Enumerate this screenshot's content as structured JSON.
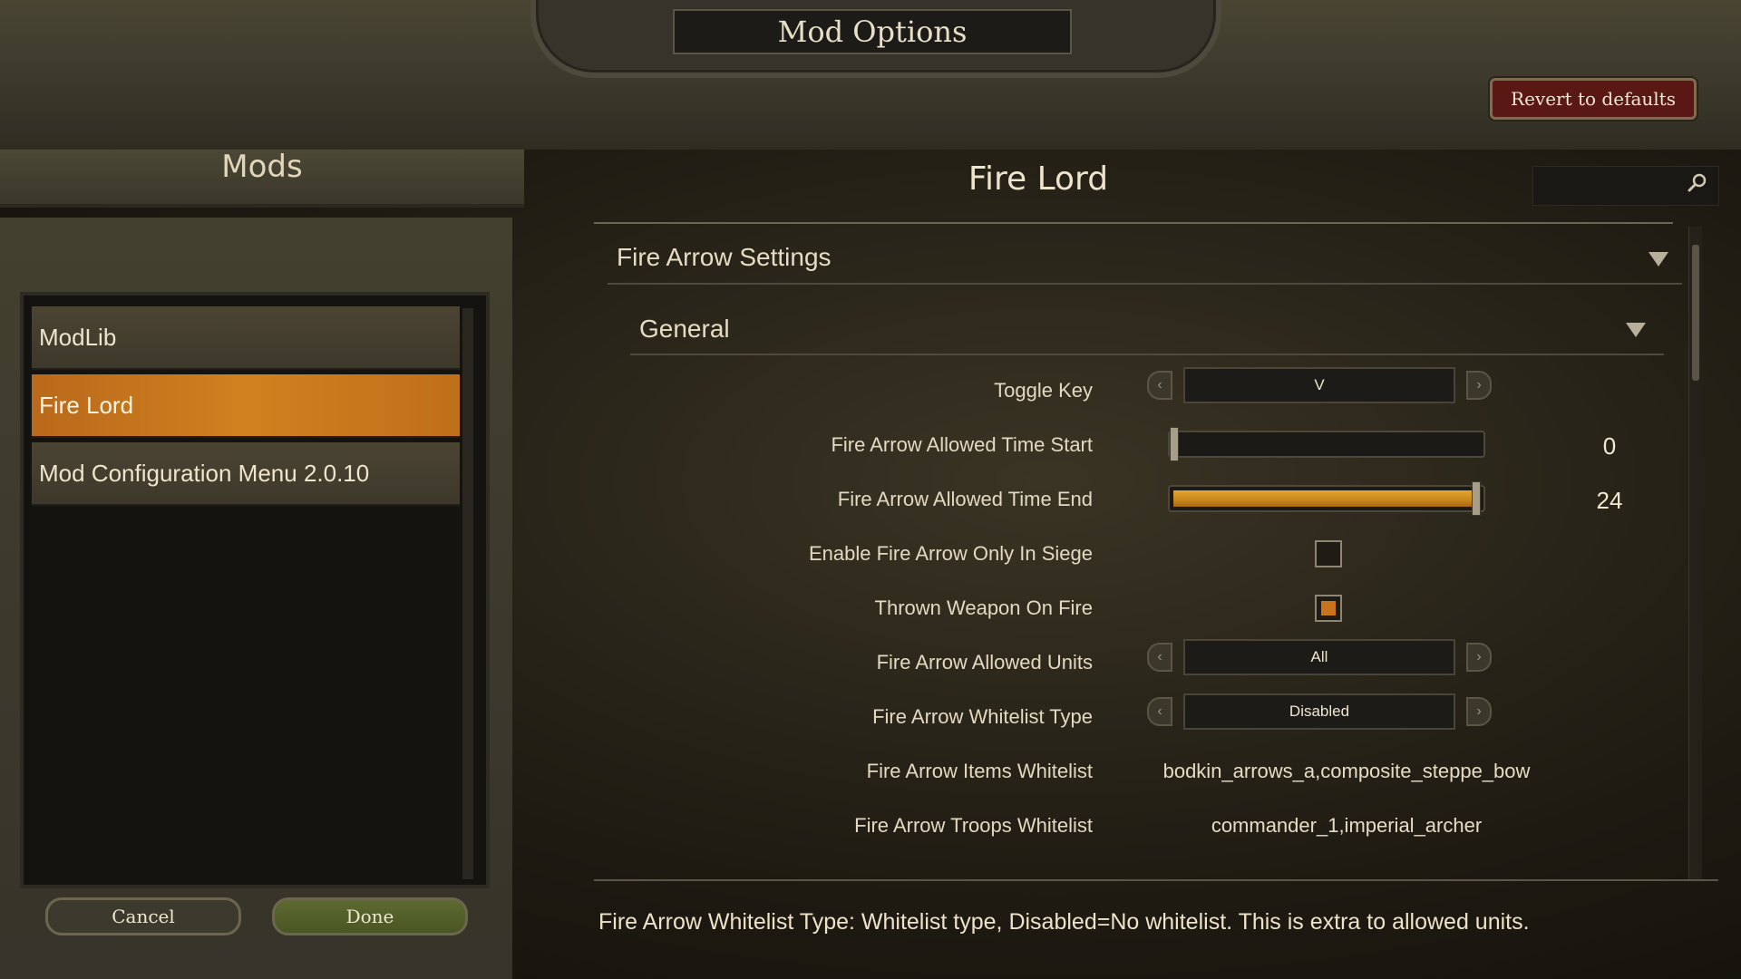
{
  "window": {
    "title": "Mod Options",
    "revert_label": "Revert to defaults"
  },
  "sidebar": {
    "title": "Mods",
    "items": [
      {
        "label": "ModLib",
        "selected": false
      },
      {
        "label": "Fire Lord",
        "selected": true
      },
      {
        "label": "Mod Configuration Menu 2.0.10",
        "selected": false
      }
    ],
    "cancel_label": "Cancel",
    "done_label": "Done"
  },
  "panel": {
    "title": "Fire Lord",
    "search": {
      "placeholder": "",
      "icon": "search-icon"
    },
    "group": {
      "title": "Fire Arrow Settings",
      "subgroup": {
        "title": "General",
        "settings": {
          "toggle_key": {
            "label": "Toggle Key",
            "value": "V"
          },
          "time_start": {
            "label": "Fire Arrow Allowed Time Start",
            "value": "0",
            "min": 0,
            "max": 24
          },
          "time_end": {
            "label": "Fire Arrow Allowed Time End",
            "value": "24",
            "min": 0,
            "max": 24
          },
          "siege_only": {
            "label": "Enable Fire Arrow Only In Siege",
            "checked": false
          },
          "thrown_on_fire": {
            "label": "Thrown Weapon On Fire",
            "checked": true
          },
          "allowed_units": {
            "label": "Fire Arrow Allowed Units",
            "value": "All"
          },
          "whitelist_type": {
            "label": "Fire Arrow Whitelist Type",
            "value": "Disabled"
          },
          "items_whitelist": {
            "label": "Fire Arrow Items Whitelist",
            "value": "bodkin_arrows_a,composite_steppe_bow"
          },
          "troops_whitelist": {
            "label": "Fire Arrow Troops Whitelist",
            "value": "commander_1,imperial_archer"
          }
        }
      }
    },
    "description": "Fire Arrow Whitelist Type: Whitelist type, Disabled=No whitelist. This is extra to allowed units."
  },
  "colors": {
    "accent": "#c8731d",
    "selected_item": "#d0811f",
    "revert_button": "#5a1814",
    "done_button": "#5d6a30"
  }
}
